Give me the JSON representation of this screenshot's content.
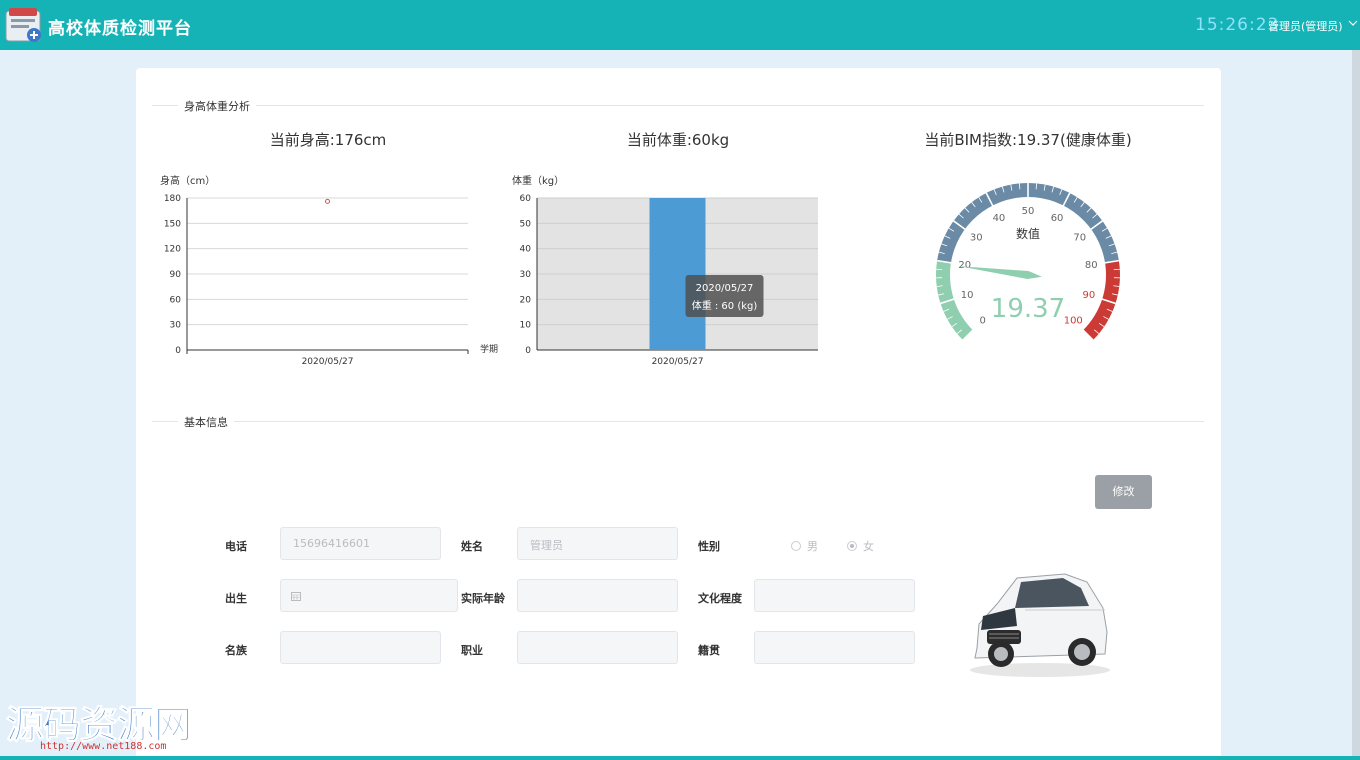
{
  "header": {
    "title": "高校体质检测平台",
    "clock": "15:26:23",
    "user": "管理员(管理员)"
  },
  "analysis": {
    "section_title": "身高体重分析",
    "height_metric": "当前身高:176cm",
    "weight_metric": "当前体重:60kg",
    "bmi_metric": "当前BIM指数:19.37(健康体重)"
  },
  "chart_data": [
    {
      "type": "scatter",
      "ylabel": "身高（cm）",
      "xlabel": "学期",
      "categories": [
        "2020/05/27"
      ],
      "values": [
        176
      ],
      "ylim": [
        0,
        180
      ],
      "yticks": [
        0,
        30,
        60,
        90,
        120,
        150,
        180
      ]
    },
    {
      "type": "bar",
      "ylabel": "体重（kg）",
      "categories": [
        "2020/05/27"
      ],
      "values": [
        60
      ],
      "ylim": [
        0,
        60
      ],
      "yticks": [
        0,
        10,
        20,
        30,
        40,
        50,
        60
      ],
      "tooltip": {
        "title": "2020/05/27",
        "text": "体重 : 60 (kg)"
      }
    },
    {
      "type": "gauge",
      "title": "数值",
      "value": 19.37,
      "value_label": "19.37",
      "range": [
        0,
        100
      ],
      "ticks": [
        "0",
        "10",
        "20",
        "30",
        "40",
        "50",
        "60",
        "70",
        "80",
        "90",
        "100"
      ]
    }
  ],
  "basic_info": {
    "section_title": "基本信息",
    "edit_label": "修改",
    "phone_label": "电话",
    "phone_value": "15696416601",
    "name_label": "姓名",
    "name_value": "管理员",
    "gender_label": "性别",
    "gender_male": "男",
    "gender_female": "女",
    "birth_label": "出生",
    "age_label": "实际年龄",
    "education_label": "文化程度",
    "ethnicity_label": "名族",
    "job_label": "职业",
    "origin_label": "籍贯"
  },
  "watermark": {
    "text": "源码资源网",
    "url": "http://www.net188.com"
  }
}
